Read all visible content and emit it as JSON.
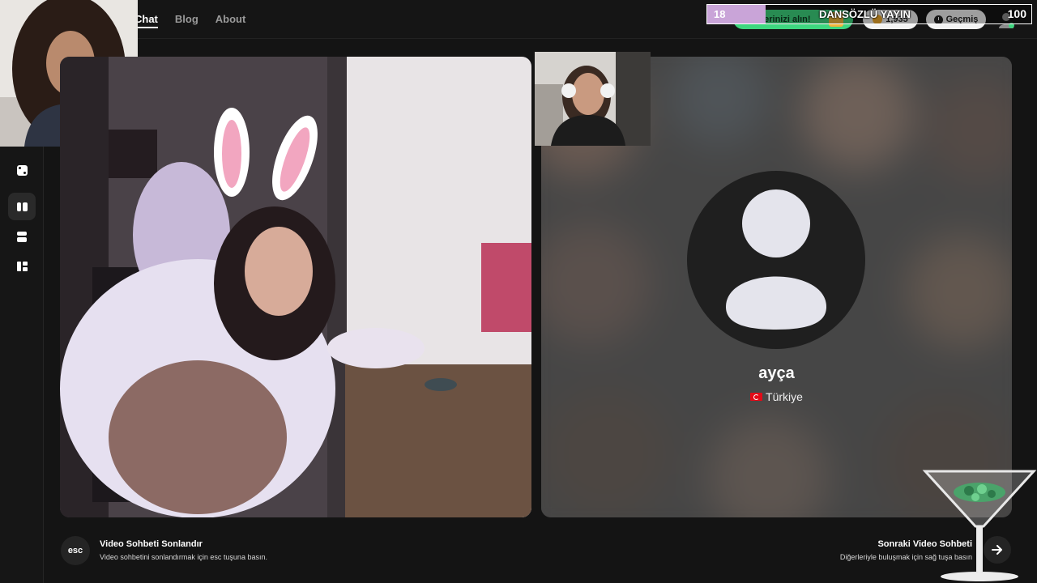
{
  "nav": {
    "items": [
      {
        "label": "Chat",
        "active": true
      },
      {
        "label": "Blog",
        "active": false
      },
      {
        "label": "About",
        "active": false
      }
    ]
  },
  "header": {
    "promo_label": "llerinizi alın!",
    "coins_value": "1,935",
    "history_label": "Geçmiş"
  },
  "stream_overlay": {
    "goal_start": "18",
    "goal_title": "DANSÖZLÜ YAYIN",
    "goal_end": "100",
    "progress": 0.18
  },
  "sidebar": {
    "icons": [
      "dice-icon",
      "split-columns-icon",
      "split-rows-icon",
      "grid-layout-icon"
    ]
  },
  "partner": {
    "name": "ayça",
    "country": "Türkiye"
  },
  "hints": {
    "end": {
      "key": "esc",
      "title": "Video Sohbeti Sonlandır",
      "subtitle": "Video sohbetini sonlandırmak için esc tuşuna basın."
    },
    "next": {
      "title": "Sonraki Video Sohbeti",
      "subtitle": "Diğerleriyle buluşmak için sağ tuşa basın"
    }
  },
  "colors": {
    "background": "#141414",
    "accent_green": "#3ed67f",
    "progress_fill": "#c9a4d8"
  }
}
